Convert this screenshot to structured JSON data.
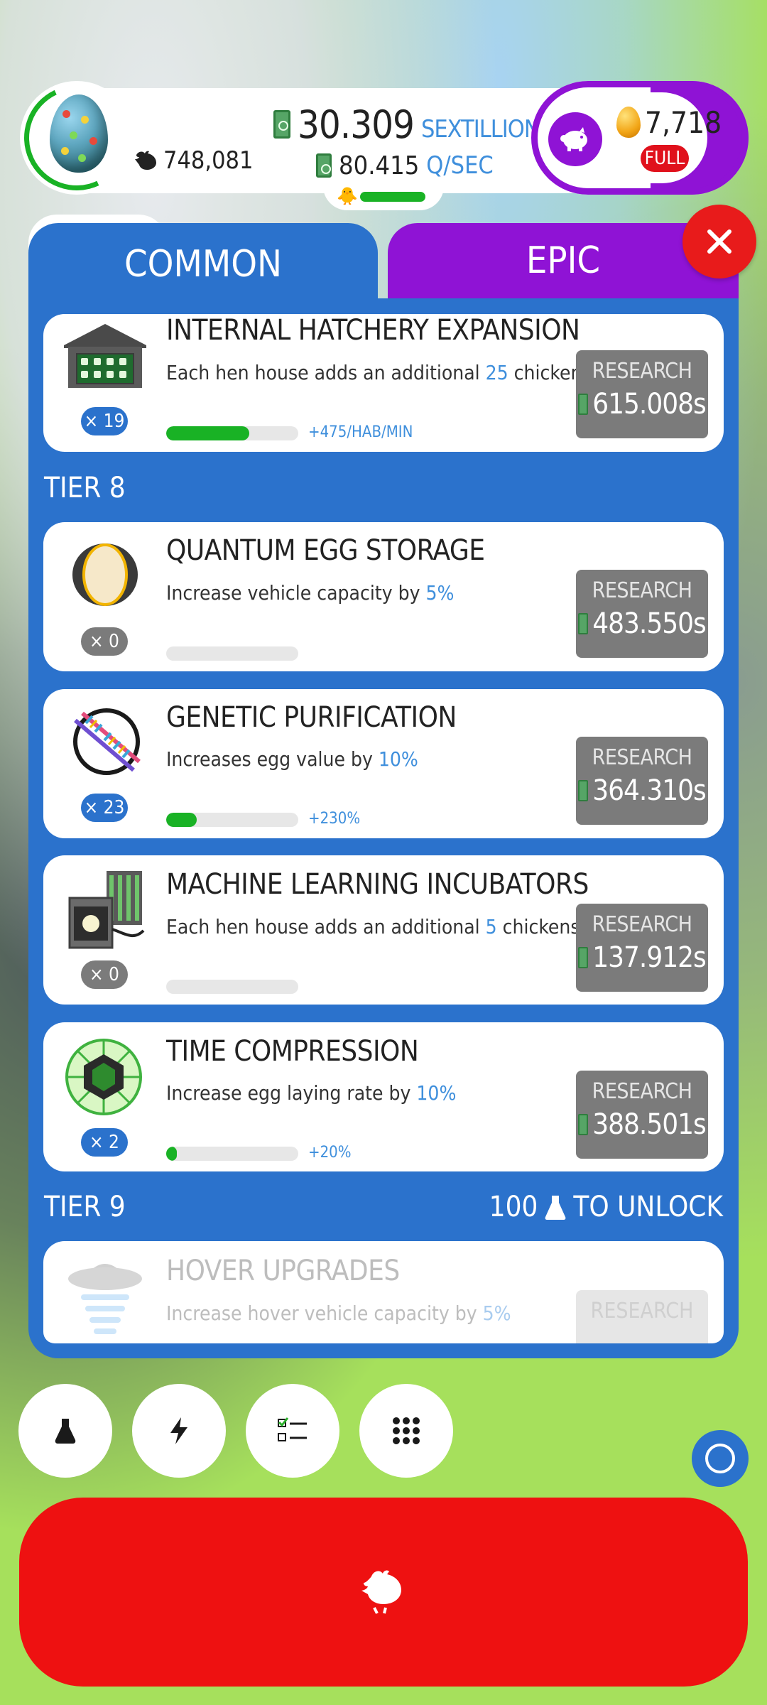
{
  "header": {
    "money_value": "30.309",
    "money_unit": "SEXTILLION",
    "rate_value": "80.415",
    "rate_unit": "Q/SEC",
    "chicken_count": "748,081",
    "golden_eggs": "7,718",
    "piggy_status": "FULL"
  },
  "tabs": [
    {
      "label": "COMMON",
      "active": true
    },
    {
      "label": "EPIC",
      "active": false
    }
  ],
  "colors": {
    "panel_blue": "#2b72cc",
    "epic_purple": "#8f13d5",
    "progress_green": "#19b225",
    "accent_blue": "#3f8fdc",
    "hatch_red": "#ee1111"
  },
  "research": {
    "button_label": "RESEARCH",
    "current": {
      "title": "INTERNAL HATCHERY EXPANSION",
      "desc_before": "Each hen house adds an additional ",
      "desc_highlight": "25",
      "desc_after": " chickens/min",
      "count": "× 19",
      "progress": 0.63,
      "bonus": "+475/HAB/MIN",
      "time": "615.008s",
      "icon": "hen-house-icon"
    },
    "tier8_label": "TIER 8",
    "tier8": [
      {
        "title": "QUANTUM EGG STORAGE",
        "desc_before": "Increase vehicle capacity by ",
        "desc_highlight": "5%",
        "desc_after": "",
        "count": "× 0",
        "progress": 0,
        "bonus": "",
        "time": "483.550s",
        "icon": "egg-storage-icon"
      },
      {
        "title": "GENETIC PURIFICATION",
        "desc_before": "Increases egg value by ",
        "desc_highlight": "10%",
        "desc_after": "",
        "count": "× 23",
        "progress": 0.23,
        "bonus": "+230%",
        "time": "364.310s",
        "icon": "dna-icon"
      },
      {
        "title": "MACHINE LEARNING INCUBATORS",
        "desc_before": "Each hen house adds an additional ",
        "desc_highlight": "5",
        "desc_after": " chickens/min",
        "count": "× 0",
        "progress": 0,
        "bonus": "",
        "time": "137.912s",
        "icon": "incubator-icon"
      },
      {
        "title": "TIME COMPRESSION",
        "desc_before": "Increase egg laying rate by ",
        "desc_highlight": "10%",
        "desc_after": "",
        "count": "× 2",
        "progress": 0.08,
        "bonus": "+20%",
        "time": "388.501s",
        "icon": "time-crystal-icon"
      }
    ],
    "tier9_label": "TIER 9",
    "tier9_unlock_count": "100",
    "tier9_unlock_text": "TO UNLOCK",
    "tier9_locked": {
      "title": "HOVER UPGRADES",
      "desc_before": "Increase hover vehicle capacity by ",
      "desc_highlight": "5%",
      "desc_after": ""
    }
  },
  "bottom_bar": {
    "buttons": [
      "flask-icon",
      "lightning-icon",
      "checklist-icon",
      "grid-icon"
    ],
    "hatch_icon": "chicken-icon"
  }
}
